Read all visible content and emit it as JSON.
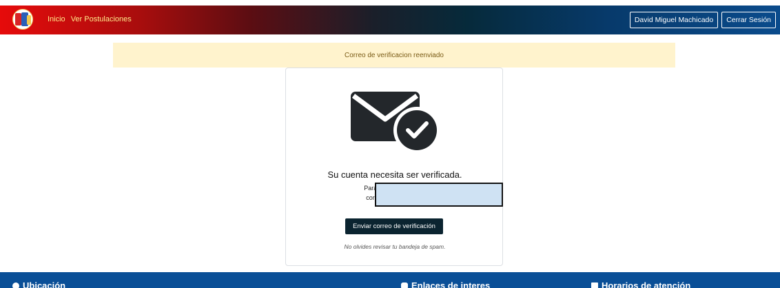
{
  "navbar": {
    "links": [
      "Inicio",
      "Ver Postulaciones"
    ],
    "user_label": "David Miguel Machicado",
    "logout_label": "Cerrar Sesión"
  },
  "alert": {
    "message": "Correo de verificacion reenviado"
  },
  "card": {
    "icon": "envelope-check-icon",
    "title": "Su cuenta necesita ser verificada.",
    "text_line1": "Para acceder y poder r",
    "text_line2": "correo de verificación",
    "button_label": "Enviar correo de verificación",
    "spam_note": "No olvides revisar tu bandeja de spam."
  },
  "footer": {
    "sections": [
      "Ubicación",
      "Enlaces de interes",
      "Horarios de atención"
    ]
  },
  "colors": {
    "alert_bg": "#fff3cd",
    "button_bg": "#0b2430",
    "footer_bg": "#0a4f97",
    "nav_link": "#ffe98a"
  }
}
